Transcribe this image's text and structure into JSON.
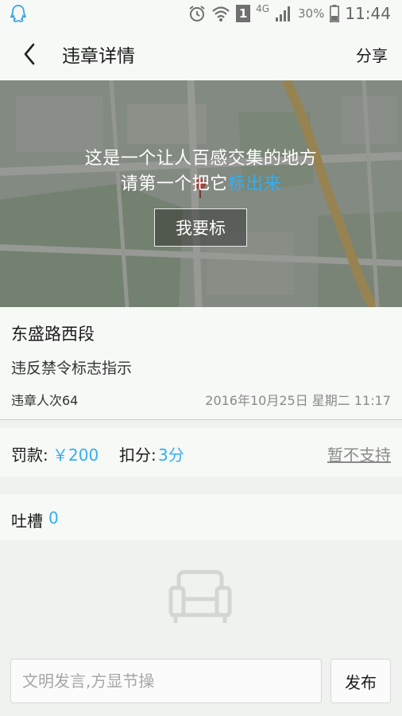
{
  "status_bar": {
    "network": "4G",
    "sim_slot": "1",
    "battery": "30%",
    "time": "11:44"
  },
  "header": {
    "title": "违章详情",
    "share_label": "分享"
  },
  "map_banner": {
    "line1": "这是一个让人百感交集的地方",
    "line2_prefix": "请第一个把它",
    "line2_highlight": "标出来",
    "button_label": "我要标",
    "highlight_color": "#35aef2"
  },
  "violation": {
    "road": "东盛路西段",
    "type": "违反禁令标志指示",
    "count_text": "违章人次64",
    "datetime": "2016年10月25日 星期二 11:17"
  },
  "penalty": {
    "fine_label": "罚款:",
    "fine_value": "￥200",
    "points_label": "扣分:",
    "points_value": "3分",
    "unsupported_label": "暂不支持"
  },
  "comments": {
    "label": "吐槽",
    "count": "0"
  },
  "input_bar": {
    "placeholder": "文明发言,方显节操",
    "publish_label": "发布"
  },
  "icons": [
    "qq-icon",
    "alarm-icon",
    "wifi-icon",
    "sim-icon",
    "signal-icon",
    "battery-icon",
    "back-icon",
    "sofa-icon"
  ]
}
